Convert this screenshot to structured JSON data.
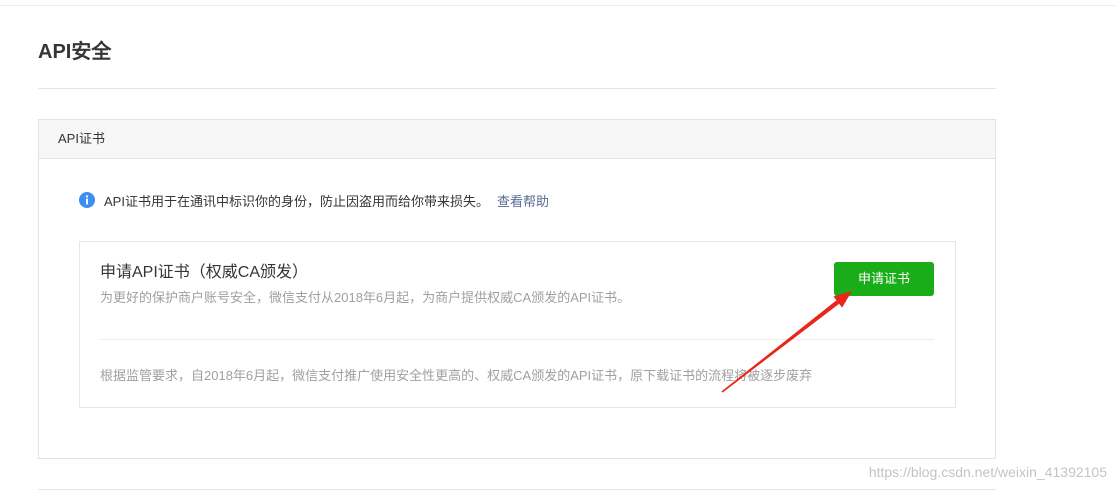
{
  "page": {
    "title": "API安全"
  },
  "certificate_panel": {
    "header": "API证书",
    "info": {
      "icon": "info-circle-icon",
      "text": "API证书用于在通讯中标识你的身份，防止因盗用而给你带来损失。",
      "help_link": "查看帮助"
    },
    "apply_card": {
      "title": "申请API证书（权威CA颁发）",
      "description": "为更好的保护商户账号安全，微信支付从2018年6月起，为商户提供权威CA颁发的API证书。",
      "apply_button": "申请证书",
      "notice": "根据监管要求，自2018年6月起，微信支付推广使用安全性更高的、权威CA颁发的API证书，原下载证书的流程将被逐步废弃"
    }
  },
  "watermark": "https://blog.csdn.net/weixin_41392105",
  "colors": {
    "accent_green": "#1aad19",
    "link_blue": "#576b95",
    "info_blue": "#3d8ef0",
    "annotation_red": "#e8261c"
  }
}
